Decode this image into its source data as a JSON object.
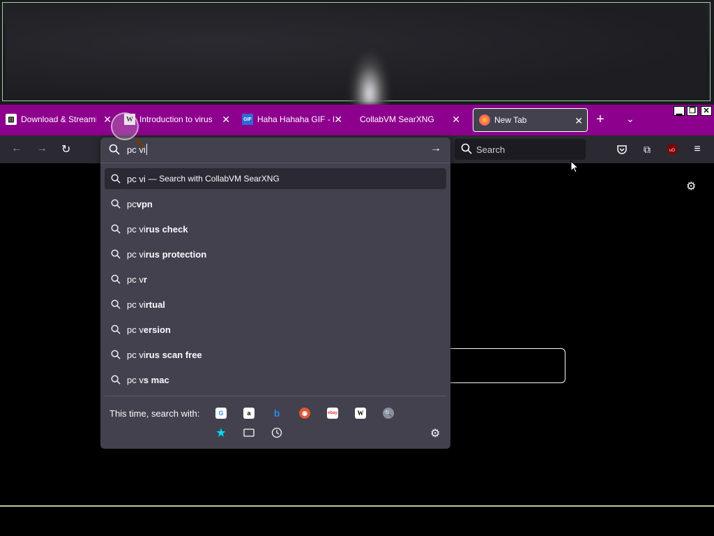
{
  "tabs": [
    {
      "title": "Download & Streaming",
      "favicon": "archive-icon"
    },
    {
      "title": "Introduction to viruses",
      "favicon": "wikipedia-icon"
    },
    {
      "title": "Haha Hahaha GIF - Ha",
      "favicon": "gif-icon"
    },
    {
      "title": "CollabVM SearXNG",
      "favicon": ""
    },
    {
      "title": "New Tab",
      "favicon": "firefox-icon"
    }
  ],
  "nav": {
    "search_placeholder": "Search"
  },
  "urlbar": {
    "typed": "pc vi",
    "selected_action": "— Search with CollabVM SearXNG"
  },
  "suggestions": [
    {
      "typed": "pc ",
      "rest": "vpn"
    },
    {
      "typed": "pc vi",
      "rest": "rus check"
    },
    {
      "typed": "pc vi",
      "rest": "rus protection"
    },
    {
      "typed": "pc v",
      "rest": "r"
    },
    {
      "typed": "pc vi",
      "rest": "rtual"
    },
    {
      "typed": "pc v",
      "rest": "ersion"
    },
    {
      "typed": "pc vi",
      "rest": "rus scan free"
    },
    {
      "typed": "pc v",
      "rest": "s mac"
    }
  ],
  "one_off": {
    "label": "This time, search with:",
    "engines": [
      "google",
      "amazon",
      "bing",
      "duckduckgo",
      "ebay",
      "wikipedia",
      "searxng"
    ],
    "modes": [
      "bookmarks-star",
      "tabs",
      "history"
    ]
  },
  "colors": {
    "tabbar": "#8d008d",
    "toolbar": "#2b2a33",
    "panel": "#42414d",
    "accent_star": "#00ddff"
  }
}
